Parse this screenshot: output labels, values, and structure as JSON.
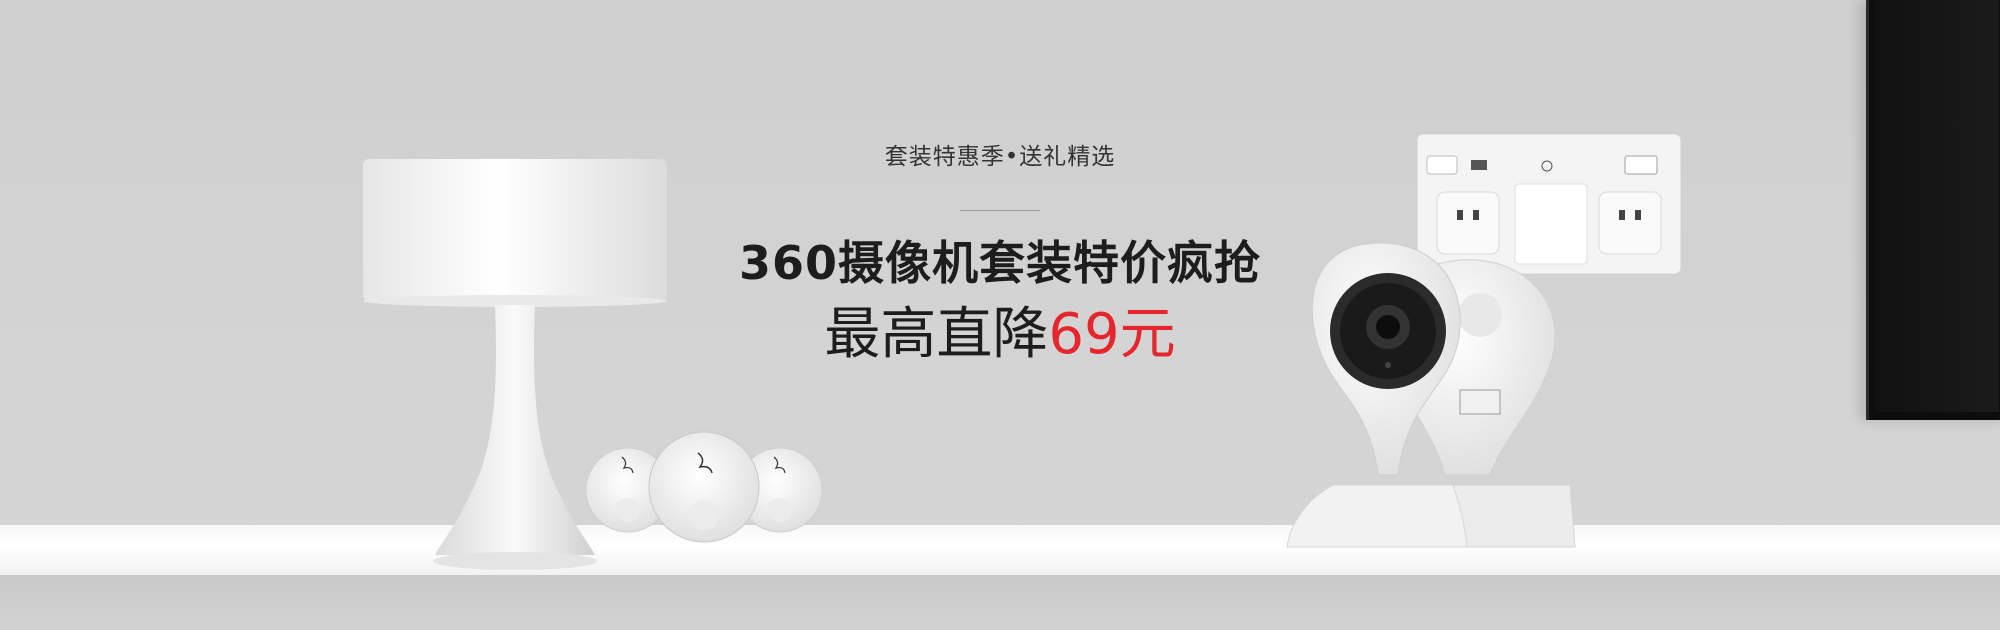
{
  "banner": {
    "subtitle": "套装特惠季•送礼精选",
    "headline": "360摄像机套装特价疯抢",
    "price_prefix": "最高直降",
    "price_value": "69元",
    "accent_color": "#e5262d"
  },
  "products": {
    "lamp": "lamp",
    "doorbell": "doorbell-buttons",
    "power_strip": "power-strip",
    "camera": "camera",
    "tv": "tv"
  }
}
